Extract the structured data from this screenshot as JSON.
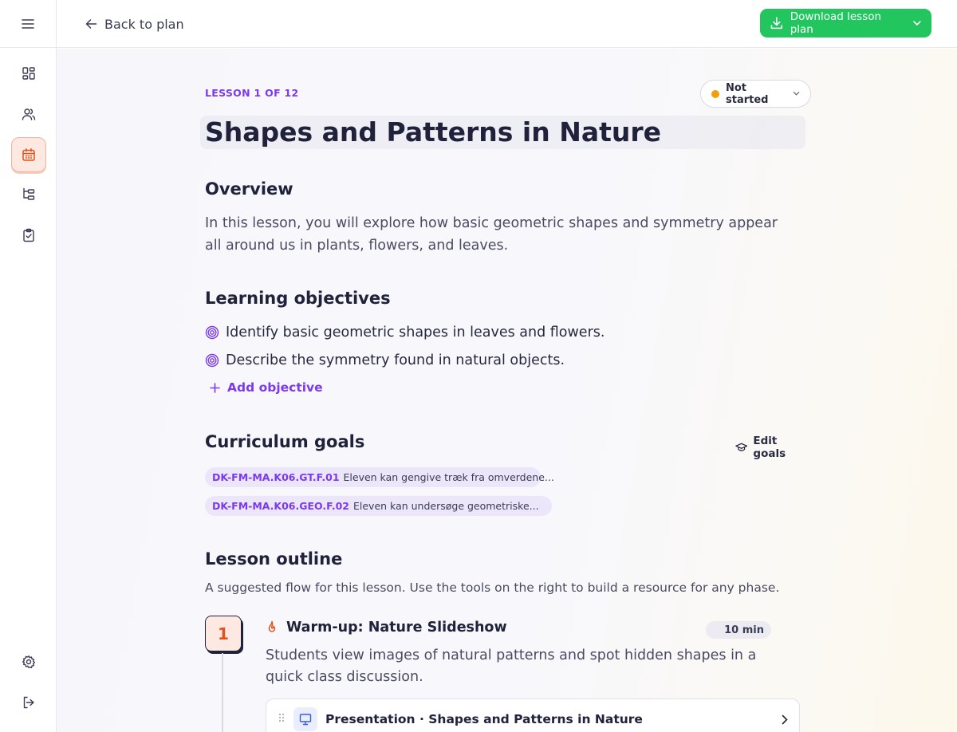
{
  "topbar": {
    "back_label": "Back to plan",
    "download_label": "Download lesson plan"
  },
  "sidebar": {
    "items": [
      {
        "icon": "dashboard-icon"
      },
      {
        "icon": "users-icon"
      },
      {
        "icon": "calendar-icon",
        "active": true
      },
      {
        "icon": "hierarchy-icon"
      },
      {
        "icon": "clipboard-check-icon"
      },
      {
        "icon": "settings-icon"
      },
      {
        "icon": "logout-icon"
      }
    ]
  },
  "lesson": {
    "counter": "LESSON 1 OF 12",
    "status": "Not started",
    "title": "Shapes and Patterns in Nature"
  },
  "overview": {
    "heading": "Overview",
    "text": "In this lesson, you will explore how basic geometric shapes and symmetry appear all around us in plants, flowers, and leaves."
  },
  "objectives": {
    "heading": "Learning objectives",
    "items": [
      "Identify basic geometric shapes in leaves and flowers.",
      "Describe the symmetry found in natural objects."
    ],
    "add_label": "Add objective"
  },
  "curriculum": {
    "heading": "Curriculum goals",
    "edit_label": "Edit goals",
    "goals": [
      {
        "code": "DK-FM-MA.K06.GT.F.01",
        "text": "Eleven kan gengive træk fra omverdene..."
      },
      {
        "code": "DK-FM-MA.K06.GEO.F.02",
        "text": "Eleven kan undersøge geometriske..."
      }
    ]
  },
  "outline": {
    "heading": "Lesson outline",
    "subtitle": "A suggested flow for this lesson. Use the tools on the right to build a resource for any phase.",
    "phases": [
      {
        "number": "1",
        "title": "Warm-up: Nature Slideshow",
        "duration": "10 min",
        "description": "Students view images of natural patterns and spot hidden shapes in a quick class discussion.",
        "resource": "Presentation · Shapes and Patterns in Nature"
      }
    ]
  },
  "colors": {
    "accent": "#7c3aed",
    "primary_button": "#22c55e",
    "status_dot": "#f59e0b",
    "phase_number": "#e0541a"
  }
}
